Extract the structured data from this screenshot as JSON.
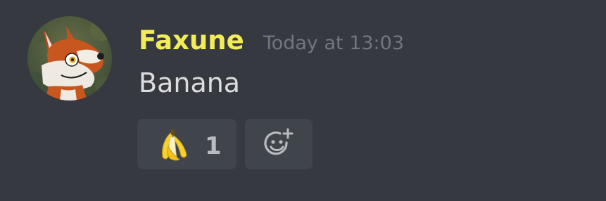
{
  "message": {
    "author": "Faxune",
    "author_color": "#f2ed57",
    "timestamp": "Today at 13:03",
    "content": "Banana"
  },
  "reactions": [
    {
      "emoji": "banana-icon",
      "count": "1"
    }
  ],
  "add_reaction": {
    "icon": "add-emoji-icon"
  },
  "colors": {
    "background": "#36393f",
    "reaction_bg": "#40444b",
    "timestamp": "#72767d",
    "text": "#dcddde"
  }
}
